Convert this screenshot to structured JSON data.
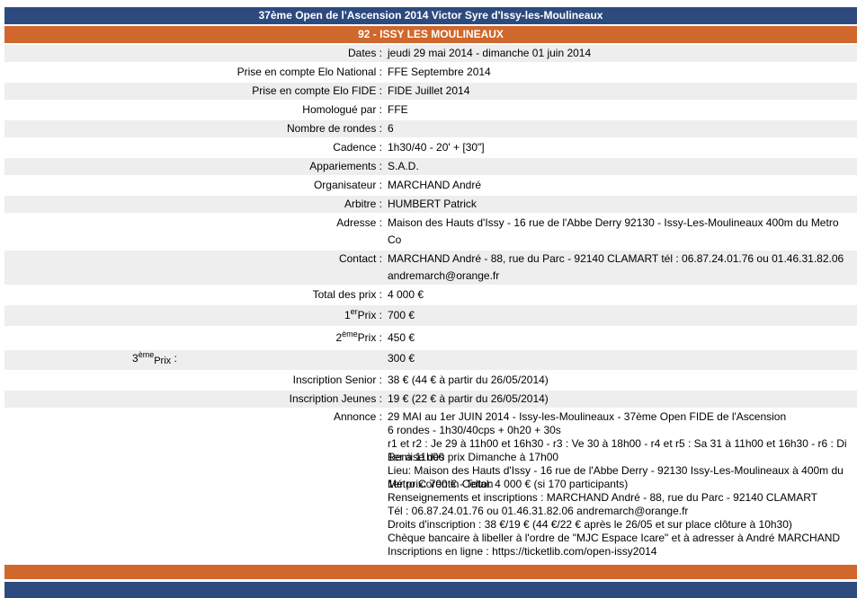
{
  "header": {
    "title": "37ème Open de l'Ascension 2014 Victor Syre d'Issy-les-Moulineaux",
    "subtitle": "92 - ISSY LES MOULINEAUX"
  },
  "rows": [
    {
      "label": "Dates :",
      "value": "jeudi 29 mai 2014 - dimanche 01 juin 2014"
    },
    {
      "label": "Prise en compte Elo National :",
      "value": "FFE Septembre 2014"
    },
    {
      "label": "Prise en compte Elo FIDE :",
      "value": "FIDE Juillet 2014"
    },
    {
      "label": "Homologué par :",
      "value": "FFE"
    },
    {
      "label": "Nombre de rondes :",
      "value": "6"
    },
    {
      "label": "Cadence :",
      "value": "1h30/40 - 20' + [30\"]"
    },
    {
      "label": "Appariements :",
      "value": "S.A.D."
    },
    {
      "label": "Organisateur :",
      "value": "MARCHAND André"
    },
    {
      "label": "Arbitre :",
      "value": "HUMBERT Patrick"
    },
    {
      "label": "Adresse :",
      "value": "Maison des Hauts d'Issy - 16 rue de l'Abbe Derry 92130 - Issy-Les-Moulineaux 400m du Metro Co"
    },
    {
      "label": "Contact :",
      "value": "MARCHAND André - 88, rue du Parc - 92140 CLAMART tél : 06.87.24.01.76 ou 01.46.31.82.06 andremarch@orange.fr"
    },
    {
      "label": "Total des prix :",
      "value": "4 000 €"
    }
  ],
  "prizes": [
    {
      "num": "1",
      "sup": "er",
      "word": "Prix",
      "colon": " :",
      "value": "700 €"
    },
    {
      "num": "2",
      "sup": "ème",
      "word": "Prix",
      "colon": " :",
      "value": "450 €"
    },
    {
      "num": "3",
      "sup": "ème",
      "word": "Prix",
      "colon": " :",
      "value": "300 €"
    }
  ],
  "rows2": [
    {
      "label": "Inscription Senior :",
      "value": "38 € (44 € à partir du 26/05/2014)"
    },
    {
      "label": "Inscription Jeunes :",
      "value": "19 € (22 € à partir du 26/05/2014)"
    }
  ],
  "annonce": {
    "label": "Annonce :",
    "lines": [
      "29 MAI au 1er JUIN 2014 - Issy-les-Moulineaux - 37ème Open FIDE de l'Ascension",
      "6 rondes - 1h30/40cps + 0h20 + 30s",
      "r1 et r2 : Je 29 à 11h00 et 16h30 - r3 : Ve 30 à 18h00 - r4 et r5 : Sa 31 à 11h00 et 16h30 - r6 : Di 1er à 11h00",
      "Remise des prix Dimanche à 17h00",
      "Lieu: Maison des Hauts d'Issy - 16 rue de l'Abbe Derry - 92130 Issy-Les-Moulineaux à 400m du Métro Corentin Celton",
      "1er prix: 700 € - Total: 4 000 € (si 170 participants)",
      "Renseignements et inscriptions : MARCHAND André - 88, rue du Parc - 92140 CLAMART",
      "Tél : 06.87.24.01.76 ou 01.46.31.82.06 andremarch@orange.fr",
      "Droits d'inscription : 38 €/19 € (44 €/22 € après le 26/05 et sur place clôture à 10h30)",
      "Chèque bancaire à libeller à l'ordre de \"MJC Espace Icare\" et à adresser à André MARCHAND",
      "Inscriptions en ligne : https://ticketlib.com/open-issy2014"
    ]
  },
  "colors": {
    "navy": "#2c4a7e",
    "orange": "#d0672c",
    "stripe": "#eeeeee"
  }
}
